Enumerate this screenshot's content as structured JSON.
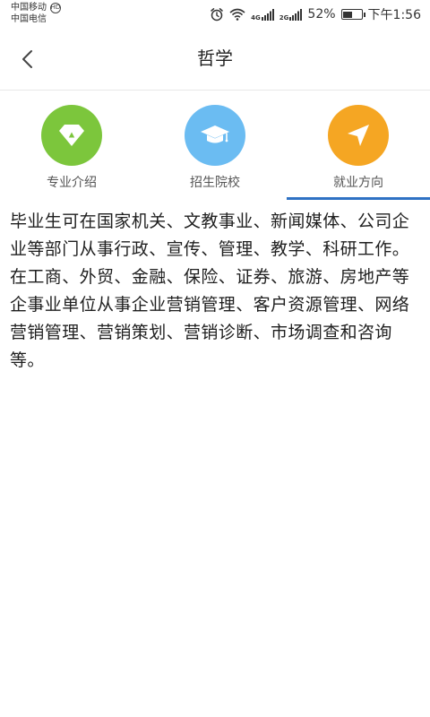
{
  "status_bar": {
    "carrier_1": "中国移动",
    "carrier_2": "中国电信",
    "carrier_badge": "HD",
    "sim1_network": "4G",
    "sim2_network": "2G",
    "battery": "52%",
    "battery_level": 0.52,
    "time": "下午1:56"
  },
  "header": {
    "title": "哲学"
  },
  "tabs": [
    {
      "label": "专业介绍",
      "color": "#7cc63c",
      "icon": "diamond-icon"
    },
    {
      "label": "招生院校",
      "color": "#6bbcf2",
      "icon": "graduation-cap-icon"
    },
    {
      "label": "就业方向",
      "color": "#f5a623",
      "icon": "navigation-arrow-icon"
    }
  ],
  "active_tab": 2,
  "accent_color": "#2f72c4",
  "content": {
    "text": "毕业生可在国家机关、文教事业、新闻媒体、公司企业等部门从事行政、宣传、管理、教学、科研工作。在工商、外贸、金融、保险、证券、旅游、房地产等企事业单位从事企业营销管理、客户资源管理、网络营销管理、营销策划、营销诊断、市场调查和咨询等。"
  }
}
